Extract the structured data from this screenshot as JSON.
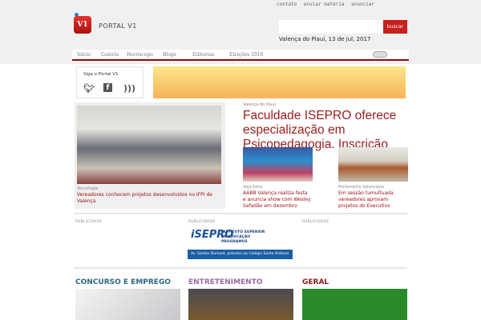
{
  "top_links": [
    "contato",
    "enviar matéria",
    "anunciar"
  ],
  "brand": {
    "logo_text": "V1",
    "name": "PORTAL V1"
  },
  "search": {
    "placeholder": "",
    "button": "buscar"
  },
  "date": "Valença do Piauí, 13 de jul, 2017",
  "nav": [
    "Início",
    "Galeria",
    "Horóscopo",
    "Blogs",
    "Editorias",
    "Eleições 2016"
  ],
  "follow": {
    "title": "Siga o Portal V1",
    "icons": [
      "twitter-icon",
      "facebook-icon",
      "rss-icon"
    ]
  },
  "featured": {
    "category": "Tecnologia",
    "title": "Vereadores conhecem projetos desenvolvidos no IFPI de Valença"
  },
  "headline": {
    "category": "Valença do Piauí",
    "title": "Faculdade ISEPRO oferece especialização em Psicopedagogia. Inscrição aberta"
  },
  "stories": [
    {
      "category": "Veja fotos",
      "title": "AABB Valença realiza festa e anuncia show com Wesley Safadão em dezembro"
    },
    {
      "category": "Parlamento Valenciano",
      "title": "Em sessão tumultuada vereadores aprovam projetos do Executivo"
    }
  ],
  "ads": {
    "label": "PUBLICIDADE",
    "isepro_logo": "iSEPRO",
    "isepro_text": "INSTITUTO SUPERIOR DE EDUCAÇÃO PROGRAMUS",
    "isepro_address": "Av. Santos Dumont, próximo ao Colégio Santo Antonio"
  },
  "sections": [
    {
      "title": "CONCURSO E EMPREGO",
      "color": "#2a6a80"
    },
    {
      "title": "ENTRETENIMENTO",
      "color": "#9a6aa8"
    },
    {
      "title": "GERAL",
      "color": "#8a1a1a"
    }
  ]
}
